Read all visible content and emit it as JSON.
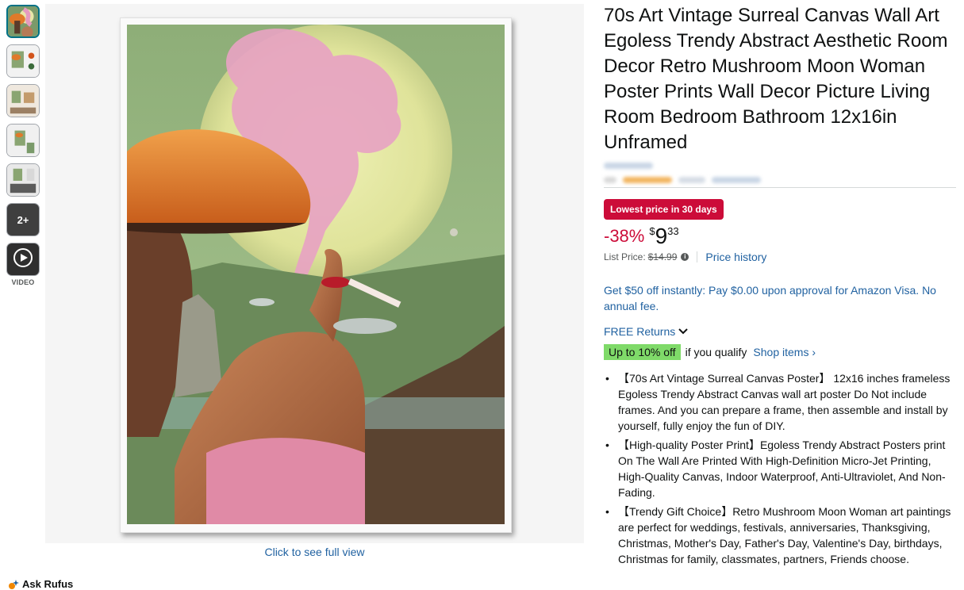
{
  "thumbnails": {
    "more_label": "2+",
    "video_label": "VIDEO"
  },
  "main_image": {
    "full_view_link": "Click to see full view"
  },
  "ask_rufus": "Ask Rufus",
  "product": {
    "title": "70s Art Vintage Surreal Canvas Wall Art Egoless Trendy Abstract Aesthetic Room Decor Retro Mushroom Moon Woman Poster Prints Wall Decor Picture Living Room Bedroom Bathroom 12x16in Unframed",
    "deal_badge": "Lowest price in 30 days",
    "discount": "-38%",
    "price_symbol": "$",
    "price_whole": "9",
    "price_fraction": "33",
    "list_price_label": "List Price:",
    "list_price": "$14.99",
    "price_history": "Price history",
    "visa_offer": "Get $50 off instantly: Pay $0.00 upon approval for Amazon Visa. No annual fee.",
    "returns": "FREE Returns",
    "off_badge": "Up to 10% off",
    "qualify_text": "if you qualify",
    "shop_items": "Shop items ›",
    "bullets": [
      "【70s Art Vintage Surreal Canvas Poster】 12x16 inches frameless Egoless Trendy Abstract Canvas wall art poster Do Not include frames. And you can prepare a frame, then assemble and install by yourself, fully enjoy the fun of DIY.",
      "【High-quality Poster Print】Egoless Trendy Abstract Posters print On The Wall Are Printed With High-Definition Micro-Jet Printing, High-Quality Canvas, Indoor Waterproof, Anti-Ultraviolet, And Non-Fading.",
      "【Trendy Gift Choice】Retro Mushroom Moon Woman art paintings are perfect for weddings, festivals, anniversaries, Thanksgiving, Christmas, Mother's Day, Father's Day, Valentine's Day, birthdays, Christmas for family, classmates, partners, Friends choose."
    ]
  },
  "colors": {
    "link": "#2162a1",
    "deal_red": "#cc0c39",
    "off_green": "#7fda69"
  }
}
